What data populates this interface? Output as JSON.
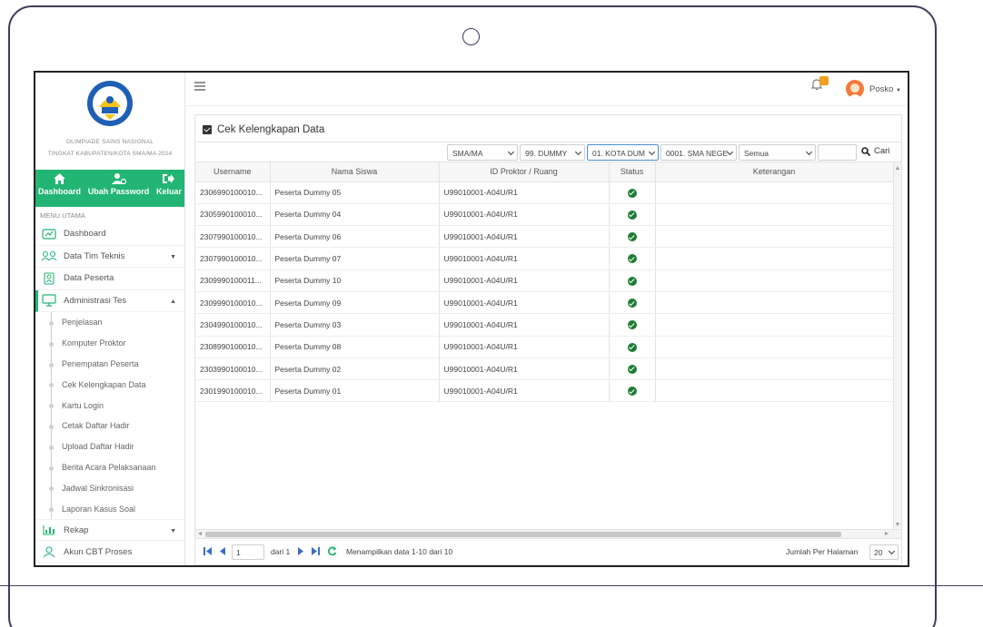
{
  "sidebar": {
    "org_line1": "OLIMPIADE SAINS NASIONAL",
    "org_line2": "TINGKAT KABUPATEN/KOTA SMA/MA 2024",
    "quick": [
      {
        "label": "Dashboard",
        "icon": "home-icon"
      },
      {
        "label": "Ubah Password",
        "icon": "user-key-icon"
      },
      {
        "label": "Keluar",
        "icon": "logout-icon"
      }
    ],
    "menu_head": "MENU UTAMA",
    "items": [
      {
        "label": "Dashboard",
        "icon": "dashboard-icon"
      },
      {
        "label": "Data Tim Teknis",
        "icon": "team-icon"
      },
      {
        "label": "Data Peserta",
        "icon": "peserta-icon"
      },
      {
        "label": "Administrasi Tes",
        "icon": "monitor-icon"
      }
    ],
    "subitems": [
      "Penjelasan",
      "Komputer Proktor",
      "Penempatan Peserta",
      "Cek Kelengkapan Data",
      "Kartu Login",
      "Cetak Daftar Hadir",
      "Upload Daftar Hadir",
      "Berita Acara Pelaksanaan",
      "Jadwal Sinkronisasi",
      "Laporan Kasus Soal"
    ],
    "bottom_items": [
      {
        "label": "Rekap",
        "icon": "chart-icon"
      },
      {
        "label": "Akun CBT Proses",
        "icon": "user-icon"
      }
    ]
  },
  "topbar": {
    "user": "Posko"
  },
  "panel": {
    "title": "Cek Kelengkapan Data",
    "filters": [
      "SMA/MA",
      "99. DUMMY",
      "01. KOTA DUM",
      "0001. SMA NEGE",
      "Semua"
    ],
    "search_label": "Cari"
  },
  "table": {
    "headers": [
      "Username",
      "Nama Siswa",
      "ID Proktor / Ruang",
      "Status",
      "Keterangan"
    ],
    "rows": [
      [
        "2306990100010...",
        "Peserta Dummy 05",
        "U99010001-A04U/R1"
      ],
      [
        "2305990100010...",
        "Peserta Dummy 04",
        "U99010001-A04U/R1"
      ],
      [
        "2307990100010...",
        "Peserta Dummy 06",
        "U99010001-A04U/R1"
      ],
      [
        "2307990100010...",
        "Peserta Dummy 07",
        "U99010001-A04U/R1"
      ],
      [
        "2309990100011...",
        "Peserta Dummy 10",
        "U99010001-A04U/R1"
      ],
      [
        "2309990100010...",
        "Peserta Dummy 09",
        "U99010001-A04U/R1"
      ],
      [
        "2304990100010...",
        "Peserta Dummy 03",
        "U99010001-A04U/R1"
      ],
      [
        "2308990100010...",
        "Peserta Dummy 08",
        "U99010001-A04U/R1"
      ],
      [
        "2303990100010...",
        "Peserta Dummy 02",
        "U99010001-A04U/R1"
      ],
      [
        "2301990100010...",
        "Peserta Dummy 01",
        "U99010001-A04U/R1"
      ]
    ]
  },
  "pager": {
    "page": "1",
    "of_label": "dari 1",
    "showing": "Menampilkan data 1-10 dari 10",
    "per_page_label": "Jumlah Per Halaman",
    "per_page": "20"
  },
  "colors": {
    "accent": "#22b573",
    "status_ok": "#1e7e34"
  }
}
